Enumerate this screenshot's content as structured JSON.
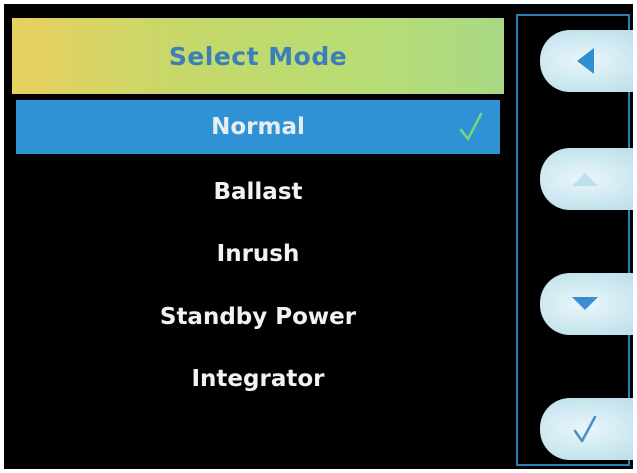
{
  "header": {
    "title": "Select Mode"
  },
  "modes": [
    {
      "label": "Normal",
      "selected": true
    },
    {
      "label": "Ballast",
      "selected": false
    },
    {
      "label": "Inrush",
      "selected": false
    },
    {
      "label": "Standby Power",
      "selected": false
    },
    {
      "label": "Integrator",
      "selected": false
    }
  ],
  "side_buttons": [
    {
      "icon": "back-arrow-icon"
    },
    {
      "icon": "up-arrow-icon"
    },
    {
      "icon": "down-arrow-icon"
    },
    {
      "icon": "checkmark-icon"
    }
  ],
  "colors": {
    "selection": "#2f92d4",
    "title_text": "#3a7fb8",
    "check": "#79d67a",
    "panel_border": "#2b7fb3"
  }
}
